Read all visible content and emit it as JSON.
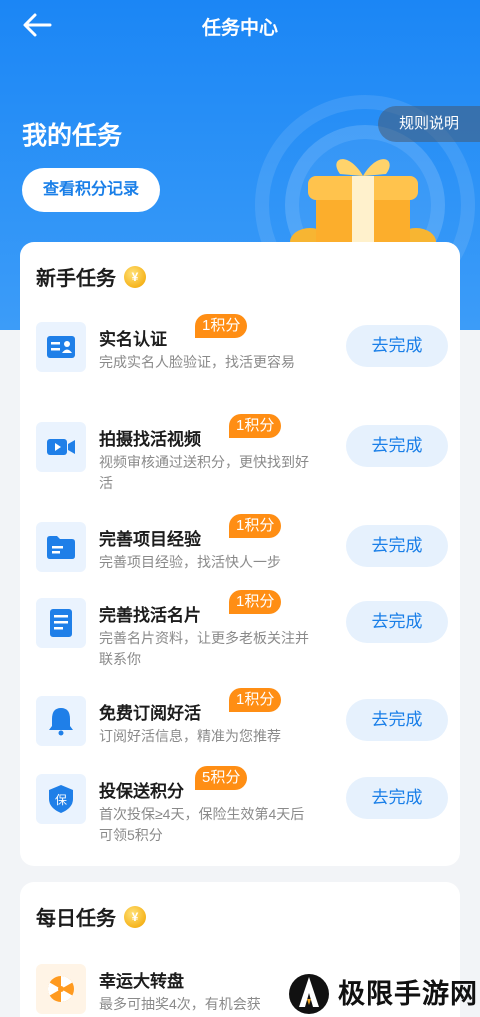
{
  "header": {
    "title": "任务中心"
  },
  "hero": {
    "title": "我的任务",
    "points_button": "查看积分记录",
    "rules_button": "规则说明"
  },
  "newbie": {
    "title": "新手任务",
    "tasks": [
      {
        "name": "实名认证",
        "badge": "1积分",
        "desc": "完成实名人脸验证，找活更容易",
        "button": "去完成",
        "icon": "id-card-icon"
      },
      {
        "name": "拍摄找活视频",
        "badge": "1积分",
        "desc": "视频审核通过送积分，更快找到好活",
        "button": "去完成",
        "icon": "video-icon"
      },
      {
        "name": "完善项目经验",
        "badge": "1积分",
        "desc": "完善项目经验，找活快人一步",
        "button": "去完成",
        "icon": "folder-icon"
      },
      {
        "name": "完善找活名片",
        "badge": "1积分",
        "desc": "完善名片资料，让更多老板关注并联系你",
        "button": "去完成",
        "icon": "document-icon"
      },
      {
        "name": "免费订阅好活",
        "badge": "1积分",
        "desc": "订阅好活信息，精准为您推荐",
        "button": "去完成",
        "icon": "bell-icon"
      },
      {
        "name": "投保送积分",
        "badge": "5积分",
        "desc": "首次投保≥4天，保险生效第4天后可领5积分",
        "button": "去完成",
        "icon": "shield-icon"
      }
    ]
  },
  "daily": {
    "title": "每日任务",
    "tasks": [
      {
        "name": "幸运大转盘",
        "desc": "最多可抽奖4次，有机会获",
        "icon": "wheel-icon"
      }
    ]
  },
  "coin_glyph": "¥",
  "watermark": {
    "text": "极限手游网"
  },
  "colors": {
    "primary": "#1a7fe8",
    "badge": "#ff8e14",
    "hero": "#1b86f5"
  }
}
